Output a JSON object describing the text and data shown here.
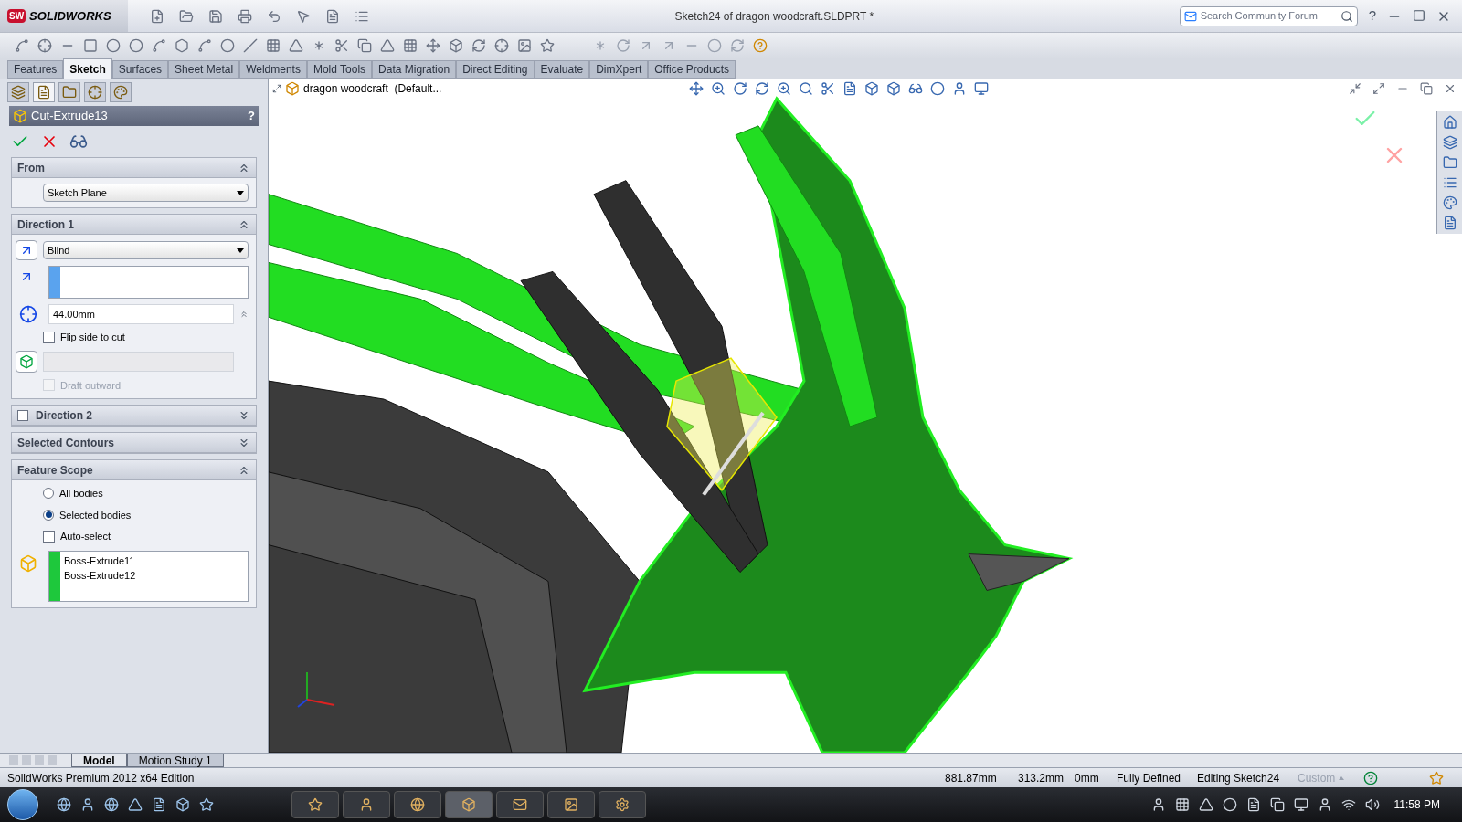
{
  "app": {
    "logo_mark": "SW",
    "logo": "SOLIDWORKS"
  },
  "window": {
    "title": "Sketch24 of dragon woodcraft.SLDPRT *"
  },
  "search": {
    "placeholder": "Search Community Forum"
  },
  "help_menu": "?",
  "tabs": [
    {
      "label": "Features",
      "selected": false
    },
    {
      "label": "Sketch",
      "selected": true
    },
    {
      "label": "Surfaces",
      "selected": false
    },
    {
      "label": "Sheet Metal",
      "selected": false
    },
    {
      "label": "Weldments",
      "selected": false
    },
    {
      "label": "Mold Tools",
      "selected": false
    },
    {
      "label": "Data Migration",
      "selected": false
    },
    {
      "label": "Direct Editing",
      "selected": false
    },
    {
      "label": "Evaluate",
      "selected": false
    },
    {
      "label": "DimXpert",
      "selected": false
    },
    {
      "label": "Office Products",
      "selected": false
    }
  ],
  "feature_tree": {
    "label": "dragon woodcraft  (Default..."
  },
  "property_manager": {
    "title": "Cut-Extrude13",
    "help": "?",
    "from": {
      "title": "From",
      "expanded": true,
      "value": "Sketch Plane"
    },
    "direction1": {
      "title": "Direction 1",
      "expanded": true,
      "end_condition": "Blind",
      "depth": "44.00mm",
      "flip_side": {
        "label": "Flip side to cut",
        "checked": false
      },
      "draft_outward": {
        "label": "Draft outward",
        "checked": false,
        "disabled": true
      }
    },
    "direction2": {
      "title": "Direction 2",
      "checked": false,
      "expanded": false
    },
    "selected_contours": {
      "title": "Selected Contours",
      "expanded": false
    },
    "feature_scope": {
      "title": "Feature Scope",
      "expanded": true,
      "options": [
        {
          "label": "All bodies",
          "selected": false
        },
        {
          "label": "Selected bodies",
          "selected": true
        }
      ],
      "auto_select": {
        "label": "Auto-select",
        "checked": false
      },
      "bodies": [
        "Boss-Extrude11",
        "Boss-Extrude12"
      ]
    }
  },
  "bottom_tabs": [
    {
      "label": "Model",
      "selected": true
    },
    {
      "label": "Motion Study 1",
      "selected": false
    }
  ],
  "status_bar": {
    "edition": "SolidWorks Premium 2012 x64 Edition",
    "x": "881.87mm",
    "y": "313.2mm",
    "z": "0mm",
    "state": "Fully Defined",
    "mode": "Editing Sketch24",
    "units": "Custom"
  },
  "taskbar": {
    "clock": "11:58 PM"
  }
}
